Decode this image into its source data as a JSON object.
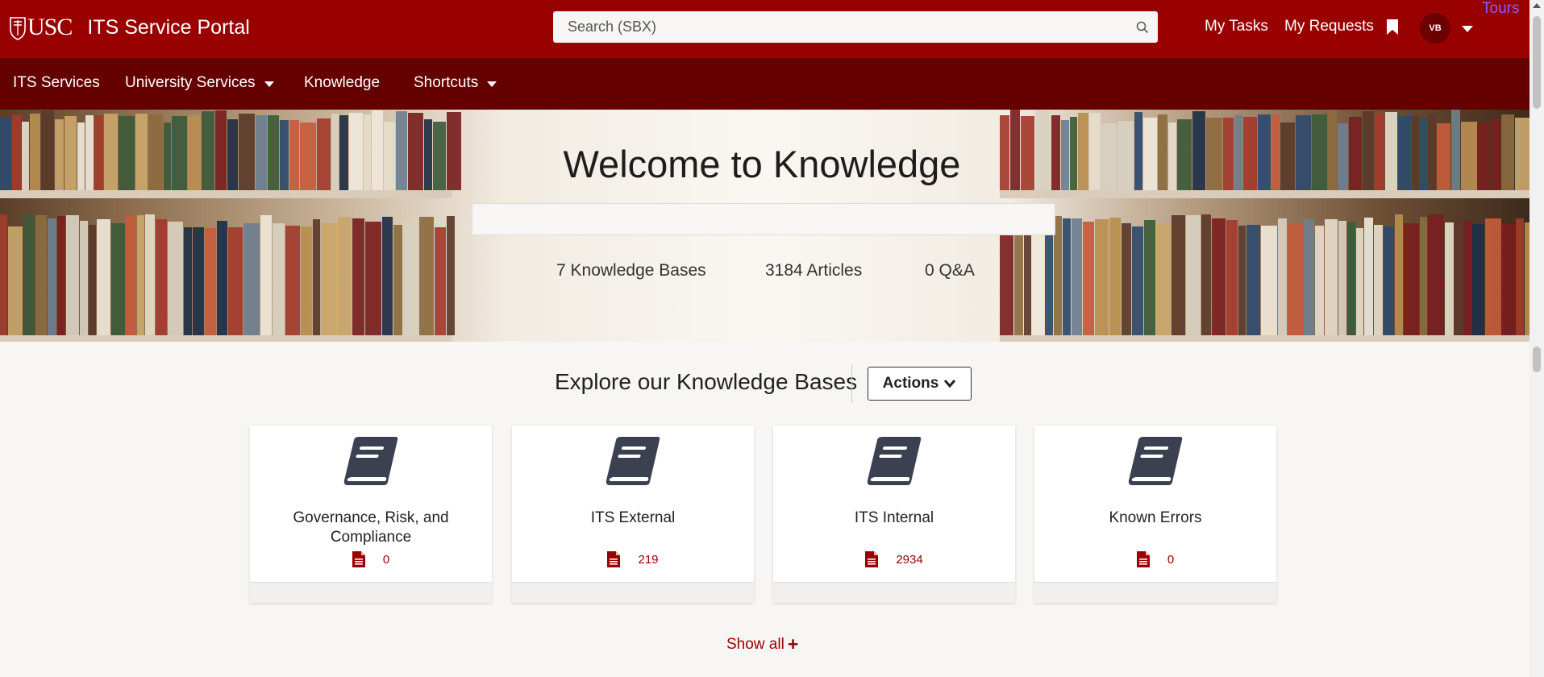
{
  "header": {
    "logo_text": "USC",
    "portal_title": "ITS Service Portal",
    "search_placeholder": "Search (SBX)",
    "my_tasks": "My Tasks",
    "my_requests": "My Requests",
    "avatar_initials": "VB",
    "tours": "Tours"
  },
  "nav": {
    "items": [
      {
        "label": "ITS Services"
      },
      {
        "label": "University Services"
      },
      {
        "label": "Knowledge"
      },
      {
        "label": "Shortcuts"
      }
    ]
  },
  "hero": {
    "title": "Welcome to Knowledge",
    "stats": [
      {
        "label": "7 Knowledge Bases"
      },
      {
        "label": "3184 Articles"
      },
      {
        "label": "0 Q&A"
      }
    ]
  },
  "explore": {
    "title": "Explore our Knowledge Bases",
    "actions_label": "Actions",
    "cards": [
      {
        "title": "Governance, Risk, and Compliance",
        "count": "0"
      },
      {
        "title": "ITS External",
        "count": "219"
      },
      {
        "title": "ITS Internal",
        "count": "2934"
      },
      {
        "title": "Known Errors",
        "count": "0"
      }
    ],
    "show_all": "Show all"
  },
  "colors": {
    "brand": "#990000",
    "nav": "#650000",
    "tours": "#8a5cff"
  }
}
